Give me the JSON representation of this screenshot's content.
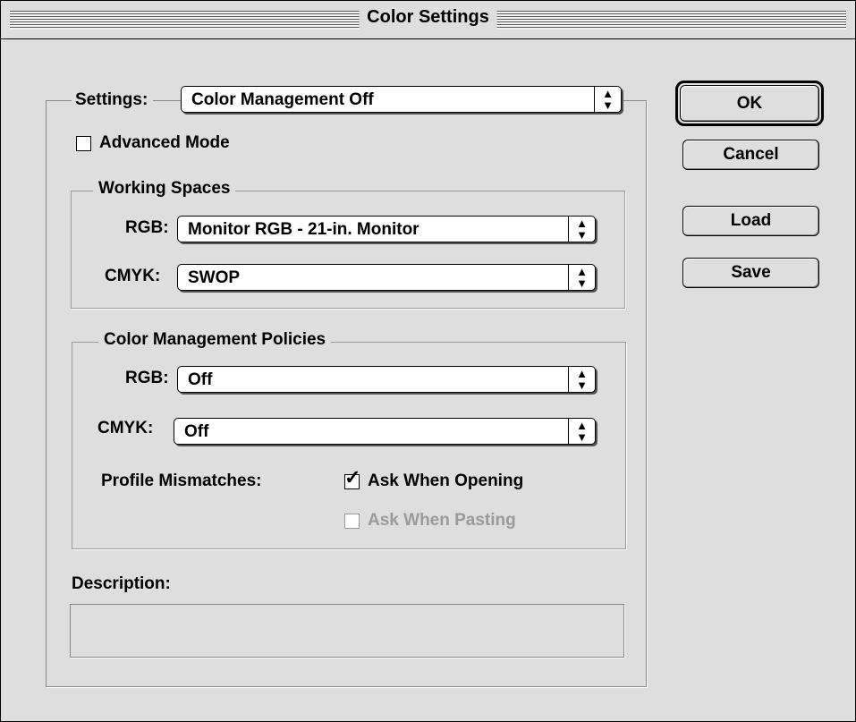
{
  "window": {
    "title": "Color Settings"
  },
  "settings": {
    "label": "Settings:",
    "value": "Color Management Off"
  },
  "advanced_mode": {
    "label": "Advanced Mode",
    "checked": false
  },
  "working_spaces": {
    "title": "Working Spaces",
    "rgb_label": "RGB:",
    "rgb_value": "Monitor RGB - 21-in. Monitor",
    "cmyk_label": "CMYK:",
    "cmyk_value": "SWOP"
  },
  "policies": {
    "title": "Color Management Policies",
    "rgb_label": "RGB:",
    "rgb_value": "Off",
    "cmyk_label": "CMYK:",
    "cmyk_value": "Off",
    "mismatch_label": "Profile Mismatches:",
    "ask_opening": {
      "label": "Ask When Opening",
      "checked": true,
      "enabled": true
    },
    "ask_pasting": {
      "label": "Ask When Pasting",
      "checked": false,
      "enabled": false
    }
  },
  "description": {
    "label": "Description:",
    "text": ""
  },
  "buttons": {
    "ok": "OK",
    "cancel": "Cancel",
    "load": "Load",
    "save": "Save"
  },
  "icons": {
    "popup_arrows": "up-down-arrows-icon",
    "checkmark": "checkmark-icon"
  },
  "colors": {
    "background": "#dedede",
    "border": "#000000",
    "disabled": "#9a9a9a"
  }
}
